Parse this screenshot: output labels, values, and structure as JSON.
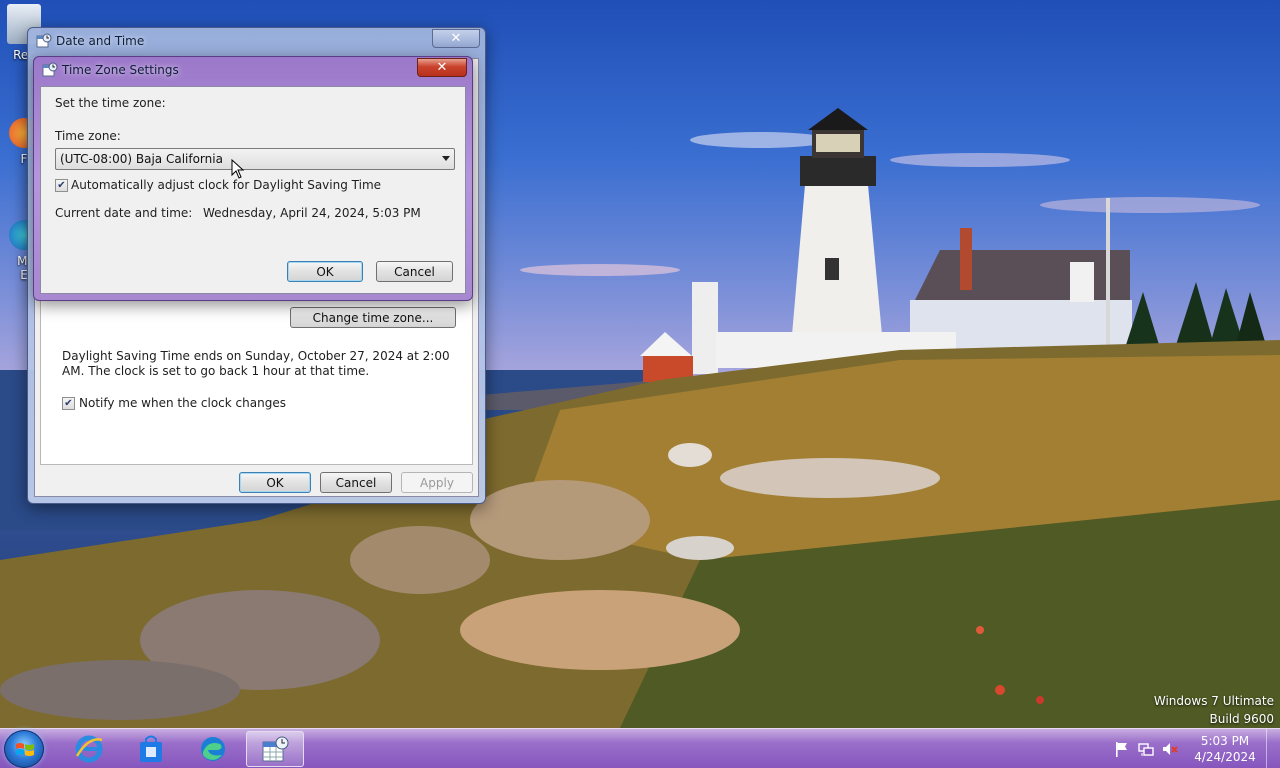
{
  "desktop": {
    "icons": [
      {
        "label": "Rec",
        "icon": "recycle-bin-icon"
      },
      {
        "label": "F",
        "icon": "firefox-icon"
      },
      {
        "label": "Mi",
        "icon": "edge-icon"
      },
      {
        "label": "E",
        "icon": "shortcut-icon"
      }
    ],
    "watermark": {
      "line1": "Windows 7 Ultimate",
      "line2": "Build 9600"
    }
  },
  "date_time_dialog": {
    "title": "Date and Time",
    "change_tz_button": "Change time zone...",
    "dst_text": "Daylight Saving Time ends on Sunday, October 27, 2024 at 2:00 AM. The clock is set to go back 1 hour at that time.",
    "notify_label": "Notify me when the clock changes",
    "notify_checked": true,
    "ok": "OK",
    "cancel": "Cancel",
    "apply": "Apply"
  },
  "tz_dialog": {
    "title": "Time Zone Settings",
    "set_label": "Set the time zone:",
    "tz_label": "Time zone:",
    "tz_value": "(UTC-08:00) Baja California",
    "auto_dst_label": "Automatically adjust clock for Daylight Saving Time",
    "auto_dst_checked": true,
    "current_label": "Current date and time:",
    "current_value": "Wednesday, April 24, 2024, 5:03 PM",
    "ok": "OK",
    "cancel": "Cancel"
  },
  "taskbar": {
    "items": [
      {
        "name": "internet-explorer",
        "icon": "ie-icon"
      },
      {
        "name": "store",
        "icon": "store-icon"
      },
      {
        "name": "edge",
        "icon": "edge-icon"
      },
      {
        "name": "date-time-control-panel",
        "icon": "calendar-clock-icon",
        "active": true
      }
    ],
    "tray": {
      "icons": [
        "flag-icon",
        "network-icon",
        "volume-muted-icon"
      ],
      "time": "5:03 PM",
      "date": "4/24/2024"
    }
  },
  "colors": {
    "taskbar": "#8656bd",
    "tz_frame": "#a787d0",
    "dt_frame": "#bccaec",
    "close_red": "#c9432c"
  }
}
